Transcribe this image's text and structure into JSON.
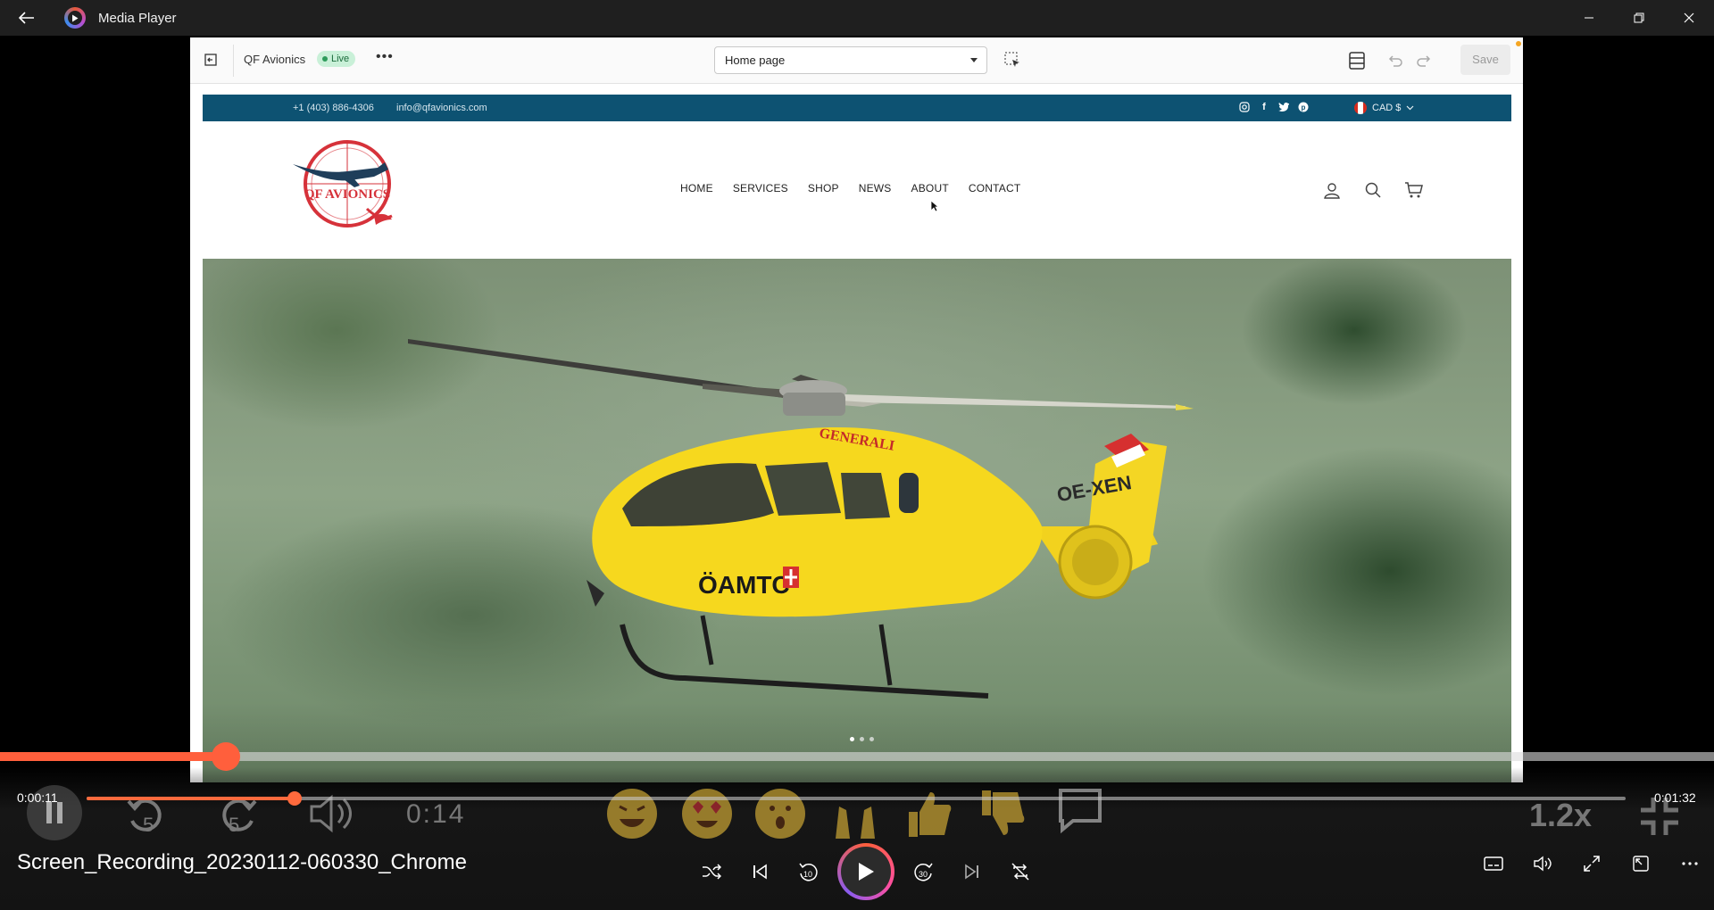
{
  "window": {
    "title": "Media Player"
  },
  "editor": {
    "store_name": "QF Avionics",
    "live_badge": "Live",
    "more_label": "•••",
    "page_select": "Home page",
    "save_label": "Save"
  },
  "site": {
    "announcement": {
      "phone": "+1 (403) 886-4306",
      "email": "info@qfavionics.com"
    },
    "currency": "CAD $",
    "logo_text": "QF AVIONICS",
    "nav": [
      "HOME",
      "SERVICES",
      "SHOP",
      "NEWS",
      "ABOUT",
      "CONTACT"
    ],
    "social_icons": [
      "instagram-icon",
      "facebook-icon",
      "twitter-icon",
      "pinterest-icon"
    ],
    "header_icons": [
      "account-icon",
      "search-icon",
      "cart-icon"
    ],
    "hero": {
      "helicopter_text": [
        "GENERALI",
        "ÖAMTC",
        "OE-XEN"
      ],
      "slide_count": 3,
      "active_slide": 1
    }
  },
  "ghost_overlay": {
    "time": "0:14",
    "speed": "1.2x",
    "skip_back": "5",
    "skip_forward": "5"
  },
  "player": {
    "current_time": "0:00:11",
    "total_time": "0:01:32",
    "progress": 0.12,
    "inner_progress": 0.135,
    "file_name": "Screen_Recording_20230112-060330_Chrome",
    "skip_back_seconds": "10",
    "skip_forward_seconds": "30"
  },
  "colors": {
    "accent": "#ff5f3c",
    "announce_bar": "#0d5272",
    "live_badge": "#c9f0d8"
  }
}
